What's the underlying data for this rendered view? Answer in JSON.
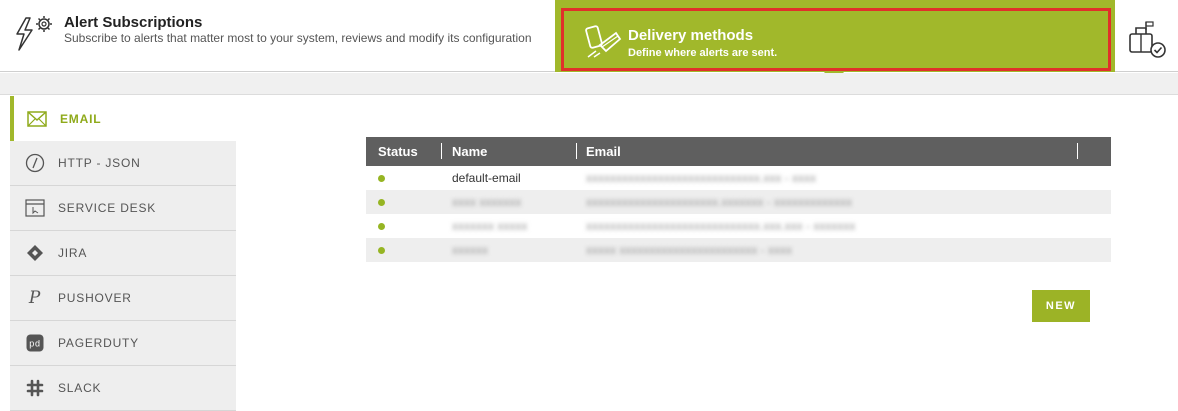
{
  "header": {
    "title": "Alert Subscriptions",
    "subtitle": "Subscribe to alerts that matter most to your system, reviews and modify its configuration"
  },
  "delivery": {
    "title": "Delivery methods",
    "subtitle": "Define where alerts are sent."
  },
  "sidebar": {
    "items": [
      {
        "label": "EMAIL",
        "icon": "envelope-icon",
        "active": true
      },
      {
        "label": "HTTP - JSON",
        "icon": "http-slash-icon",
        "active": false
      },
      {
        "label": "SERVICE DESK",
        "icon": "service-desk-icon",
        "active": false
      },
      {
        "label": "JIRA",
        "icon": "jira-diamond-icon",
        "active": false
      },
      {
        "label": "PUSHOVER",
        "icon": "pushover-p-icon",
        "active": false
      },
      {
        "label": "PAGERDUTY",
        "icon": "pagerduty-pd-icon",
        "active": false
      },
      {
        "label": "SLACK",
        "icon": "slack-hash-icon",
        "active": false
      }
    ]
  },
  "table": {
    "headers": {
      "status": "Status",
      "name": "Name",
      "email": "Email"
    },
    "rows": [
      {
        "name": "default-email",
        "email": "xxxxxxxxxxxxxxxxxxxxxxxxxxxxx.xxx - xxxx"
      },
      {
        "name": "xxxx xxxxxxx",
        "email": "xxxxxxxxxxxxxxxxxxxxxx.xxxxxxx - xxxxxxxxxxxxx"
      },
      {
        "name": "xxxxxxx xxxxx",
        "email": "xxxxxxxxxxxxxxxxxxxxxxxxxxxxx.xxx.xxx - xxxxxxx"
      },
      {
        "name": "xxxxxx",
        "email": "xxxxx xxxxxxxxxxxxxxxxxxxxxxx - xxxx"
      }
    ]
  },
  "actions": {
    "new_label": "NEW"
  },
  "colors": {
    "accent": "#a1b82b",
    "highlight": "#e0302a",
    "status_ok": "#96b523",
    "table_header": "#5f5f5f"
  }
}
